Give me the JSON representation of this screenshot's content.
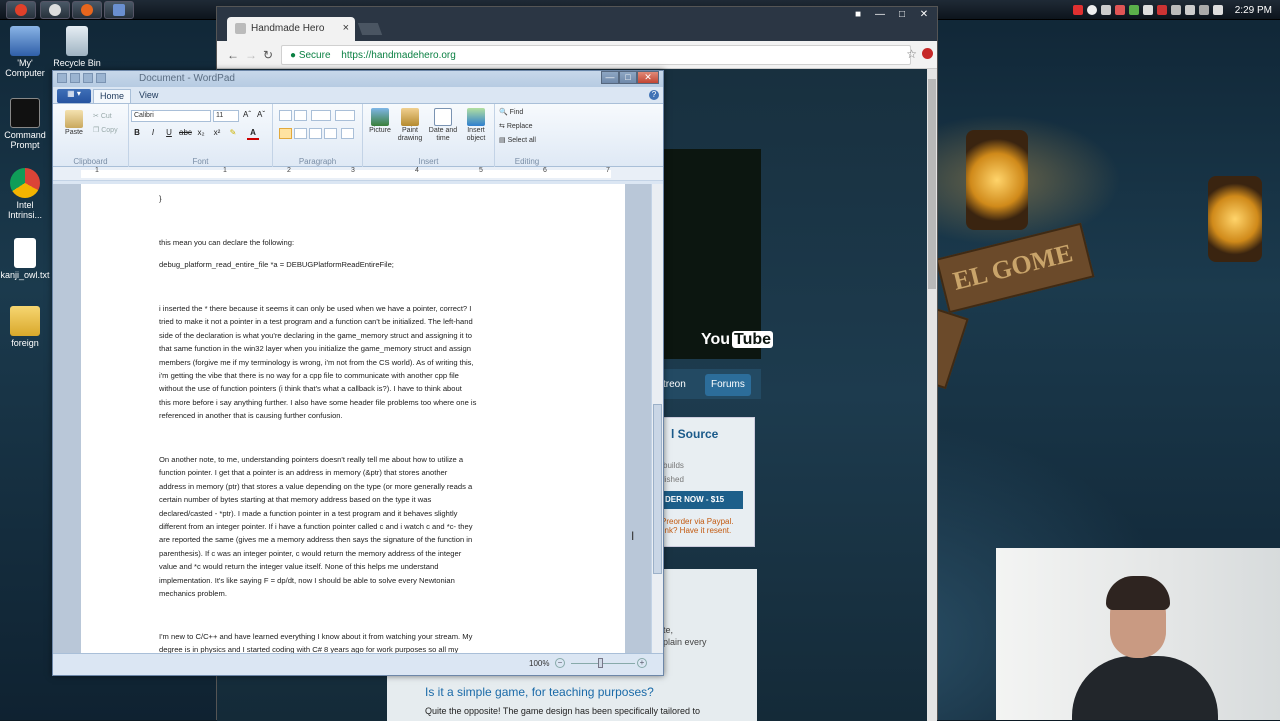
{
  "desktop": {
    "icons": [
      {
        "label": "'My' Computer"
      },
      {
        "label": "Recycle Bin"
      },
      {
        "label": "Command Prompt"
      },
      {
        "label": "Intel Intrinsi..."
      },
      {
        "label": "kanji_owl.txt"
      },
      {
        "label": "foreign"
      }
    ],
    "clock": "2:29 PM"
  },
  "browser": {
    "tab_title": "Handmade Hero",
    "tab_close": "×",
    "secure_label": "Secure",
    "url": "https://handmadehero.org",
    "page": {
      "youtube_label": "You",
      "youtube_tube": "Tube",
      "nav_partial": "treon",
      "nav_forums": "Forums",
      "source_title": "l Source",
      "source_note1": "builds",
      "source_note2": "lished",
      "order_label": "DER NOW - $15",
      "paypal1": "Preorder via Paypal.",
      "paypal2": "link? Have it resent.",
      "lower_note1": "te,",
      "lower_note2": "plain every",
      "question_title": "Is it a simple game, for teaching purposes?",
      "question_body": "Quite the opposite! The game design has been specifically tailored to"
    }
  },
  "wordpad": {
    "title": "Document - WordPad",
    "tabs": {
      "home": "Home",
      "view": "View"
    },
    "ribbon": {
      "clipboard": {
        "label": "Clipboard",
        "paste": "Paste",
        "cut": "Cut",
        "copy": "Copy"
      },
      "font": {
        "label": "Font",
        "family": "Calibri",
        "size": "11"
      },
      "paragraph": {
        "label": "Paragraph"
      },
      "insert": {
        "label": "Insert",
        "picture": "Picture",
        "paint": "Paint drawing",
        "datetime": "Date and time",
        "object": "Insert object"
      },
      "editing": {
        "label": "Editing",
        "find": "Find",
        "replace": "Replace",
        "select_all": "Select all"
      }
    },
    "ruler_numbers": [
      "1",
      "1",
      "2",
      "3",
      "4",
      "5",
      "6",
      "7"
    ],
    "document": {
      "brace": "}",
      "line1": "this mean you can declare the following:",
      "line2": "debug_platform_read_entire_file *a = DEBUGPlatformReadEntireFile;",
      "para1": "i inserted the * there because it seems it can only be used when we have a pointer, correct?  I\ntried to make it not a pointer in a test program and a function can't be initialized.  The left-hand\nside of the declaration is what you're declaring in the game_memory struct and assigning it to\nthat same function in the win32 layer when you initialize the game_memory struct and assign\nmembers (forgive me if my terminology is wrong, i'm not from the CS world).  As of writing this,\ni'm getting the vibe that there is no way for a cpp file to communicate with another cpp file\nwithout the use of function pointers (i think that's what a callback is?).  I have to think about\nthis more before i say anything further.  I also have some header file problems too where one is\nreferenced in another that is causing further confusion.",
      "para2": "On another note, to me, understanding pointers doesn't really tell me about how to utilize a\nfunction pointer.  I get that a pointer is an address in memory (&ptr) that stores another\naddress in memory (ptr) that stores a value depending on the type (or more generally reads a\ncertain number of bytes starting at that memory address based on the type it was\ndeclared/casted - *ptr).  I made a function pointer in a test program and it behaves slightly\ndifferent from an integer pointer.  If i have a function pointer called c and i watch c and *c- they\nare reported the same (gives me a memory address then says the signature of the function in\nparenthesis).  If c was an integer pointer, c would return the memory address of the integer\nvalue and *c would return the integer value itself.  None of this helps me understand\nimplementation.  It's like saying F = dp/dt, now I should be able to solve every Newtonian\nmechanics problem.",
      "para3": "I'm new to C/C++ and have learned everything I know about it from watching your stream.  My\ndegree is in physics and I started coding with C# 8 years ago for work purposes so all my"
    },
    "zoom": "100%"
  },
  "colors": {
    "ribbon_blue": "#2553a0",
    "link_blue": "#1a6aa8",
    "secure_green": "#0b8043"
  }
}
